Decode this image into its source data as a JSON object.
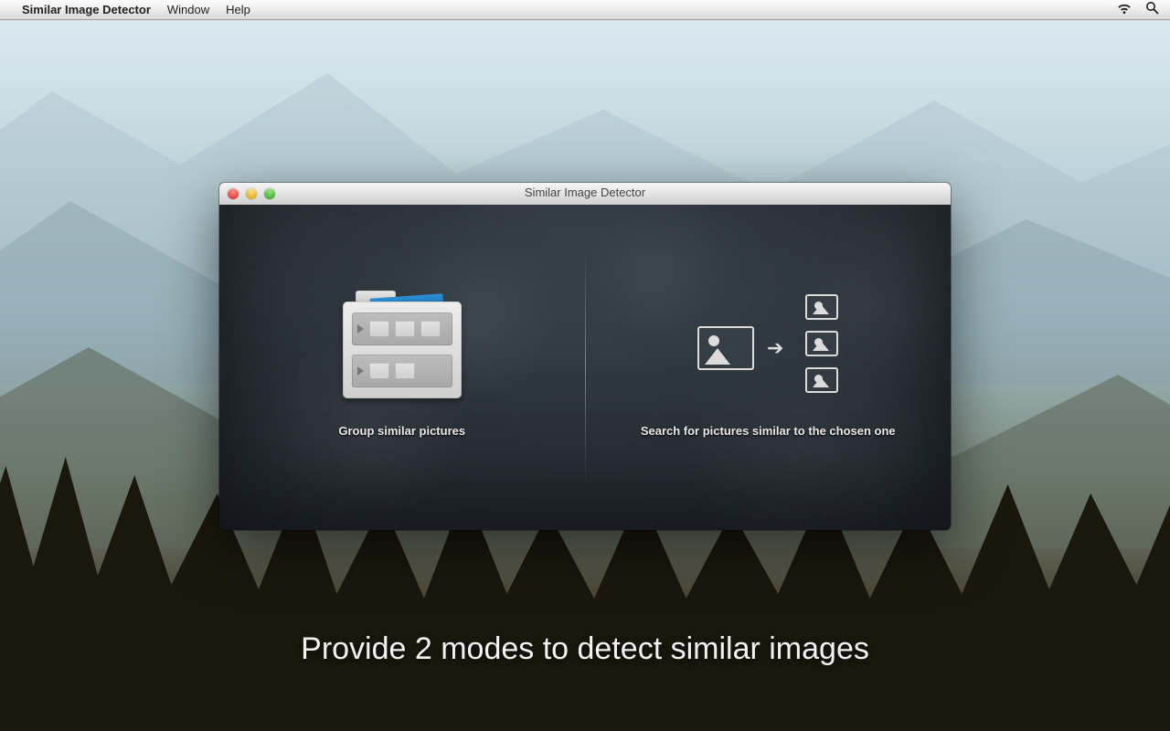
{
  "menubar": {
    "app_name": "Similar Image Detector",
    "items": [
      "Window",
      "Help"
    ]
  },
  "window": {
    "title": "Similar Image Detector",
    "modes": {
      "group_label": "Group similar pictures",
      "search_label": "Search for pictures similar to the chosen one"
    }
  },
  "caption": "Provide 2 modes to detect similar images"
}
